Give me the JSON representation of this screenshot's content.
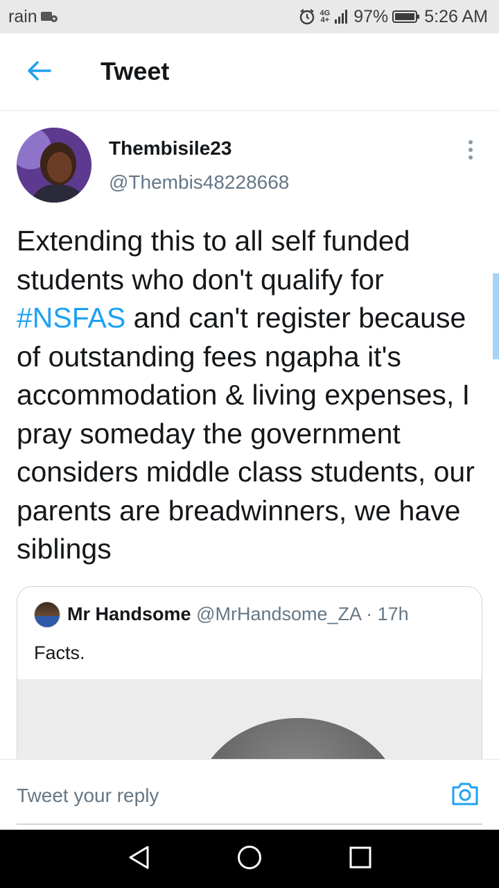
{
  "status_bar": {
    "carrier": "rain",
    "network_type": "4G",
    "network_sub": "4+",
    "battery": "97%",
    "time": "5:26 AM",
    "icons": [
      "sim-icon",
      "alarm-icon",
      "signal-icon",
      "battery-icon"
    ]
  },
  "header": {
    "title": "Tweet",
    "back_icon": "back-arrow-icon"
  },
  "tweet": {
    "display_name": "Thembisile23",
    "handle": "@Thembis48228668",
    "text_before": "Extending this to all self funded students who don't qualify for ",
    "hashtag": "#NSFAS",
    "text_after": " and can't register because of outstanding fees ngapha it's accommodation & living expenses, I pray someday the government considers middle class students, our parents are breadwinners, we have siblings",
    "more_icon": "more-vertical-icon"
  },
  "quoted_tweet": {
    "name": "Mr Handsome",
    "handle": "@MrHandsome_ZA",
    "separator": " · ",
    "time": "17h",
    "text": "Facts."
  },
  "reply": {
    "placeholder": "Tweet your reply",
    "camera_icon": "camera-icon"
  },
  "nav": {
    "icons": [
      "back-triangle-icon",
      "home-circle-icon",
      "recents-square-icon"
    ]
  },
  "colors": {
    "accent": "#1da1f2",
    "text_primary": "#14171a",
    "text_secondary": "#657786",
    "status_bar_bg": "#e9e9ea"
  }
}
